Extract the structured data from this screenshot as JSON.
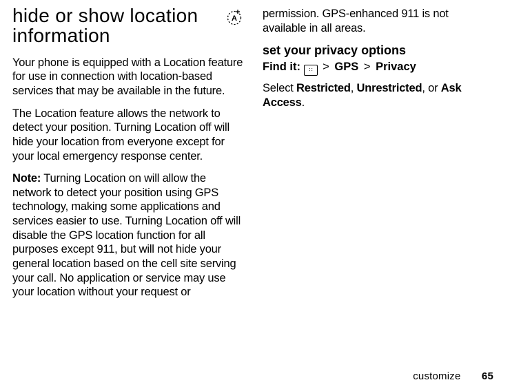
{
  "left": {
    "heading": "hide or show location information",
    "p1": "Your phone is equipped with a Location feature for use in connection with location-based services that may be available in the future.",
    "p2": "The Location feature allows the network to detect your position. Turning Location off will hide your location from everyone except for your local emergency response center.",
    "note_label": "Note:",
    "note_body": " Turning Location on will allow the network to detect your position using GPS technology, making some applications and services easier to use. Turning Location off will disable the GPS location function for all purposes except 911, but will not hide your general location based on the cell site serving your call. No application or service may use your location without your request or"
  },
  "right": {
    "cont": "permission. GPS-enhanced 911 is not available in all areas.",
    "subhead": "set your privacy options",
    "findit_label": "Find it:",
    "sep": ">",
    "crumb1": "GPS",
    "crumb2": "Privacy",
    "select_prefix": "Select ",
    "opt1": "Restricted",
    "opt2": "Unrestricted",
    "opt_or": ", or ",
    "opt3": "Ask Access",
    "period": "."
  },
  "footer": {
    "section": "customize",
    "page": "65"
  },
  "icons": {
    "badge": "location-feature-icon",
    "menu_key": "menu-key-icon"
  }
}
